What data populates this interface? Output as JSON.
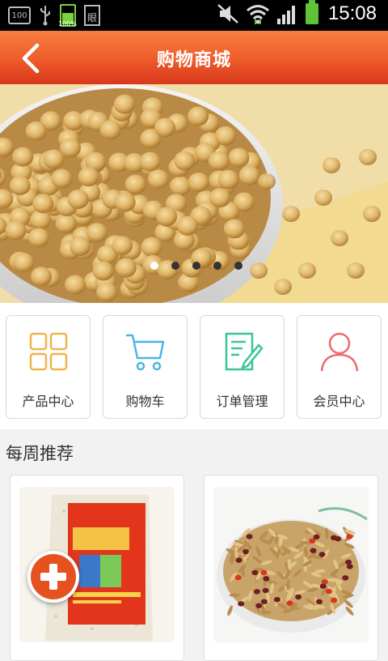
{
  "status_bar": {
    "time": "15:08",
    "notif_box": "100",
    "battery_small_pct": "100%",
    "doc_glyph": "眼",
    "icons": [
      "usb-icon",
      "battery-charge-icon",
      "screenshot-doc-icon",
      "mute-icon",
      "wifi-icon",
      "signal-icon",
      "battery-icon"
    ]
  },
  "header": {
    "title": "购物商城",
    "back_icon": "chevron-left-icon"
  },
  "banner": {
    "dots_count": 5,
    "active_dot": 0
  },
  "menu": {
    "items": [
      {
        "label": "产品中心",
        "icon": "grid-icon",
        "color": "#f2b24a"
      },
      {
        "label": "购物车",
        "icon": "cart-icon",
        "color": "#4bb6e6"
      },
      {
        "label": "订单管理",
        "icon": "order-icon",
        "color": "#3cc49b"
      },
      {
        "label": "会员中心",
        "icon": "user-icon",
        "color": "#ef6a6a"
      }
    ]
  },
  "weekly": {
    "title": "每周推荐",
    "products": [
      {
        "name": "",
        "image": "rice-bag-image"
      },
      {
        "name": "",
        "image": "grain-bowl-image"
      }
    ]
  },
  "fab": {
    "icon": "plus-icon"
  }
}
